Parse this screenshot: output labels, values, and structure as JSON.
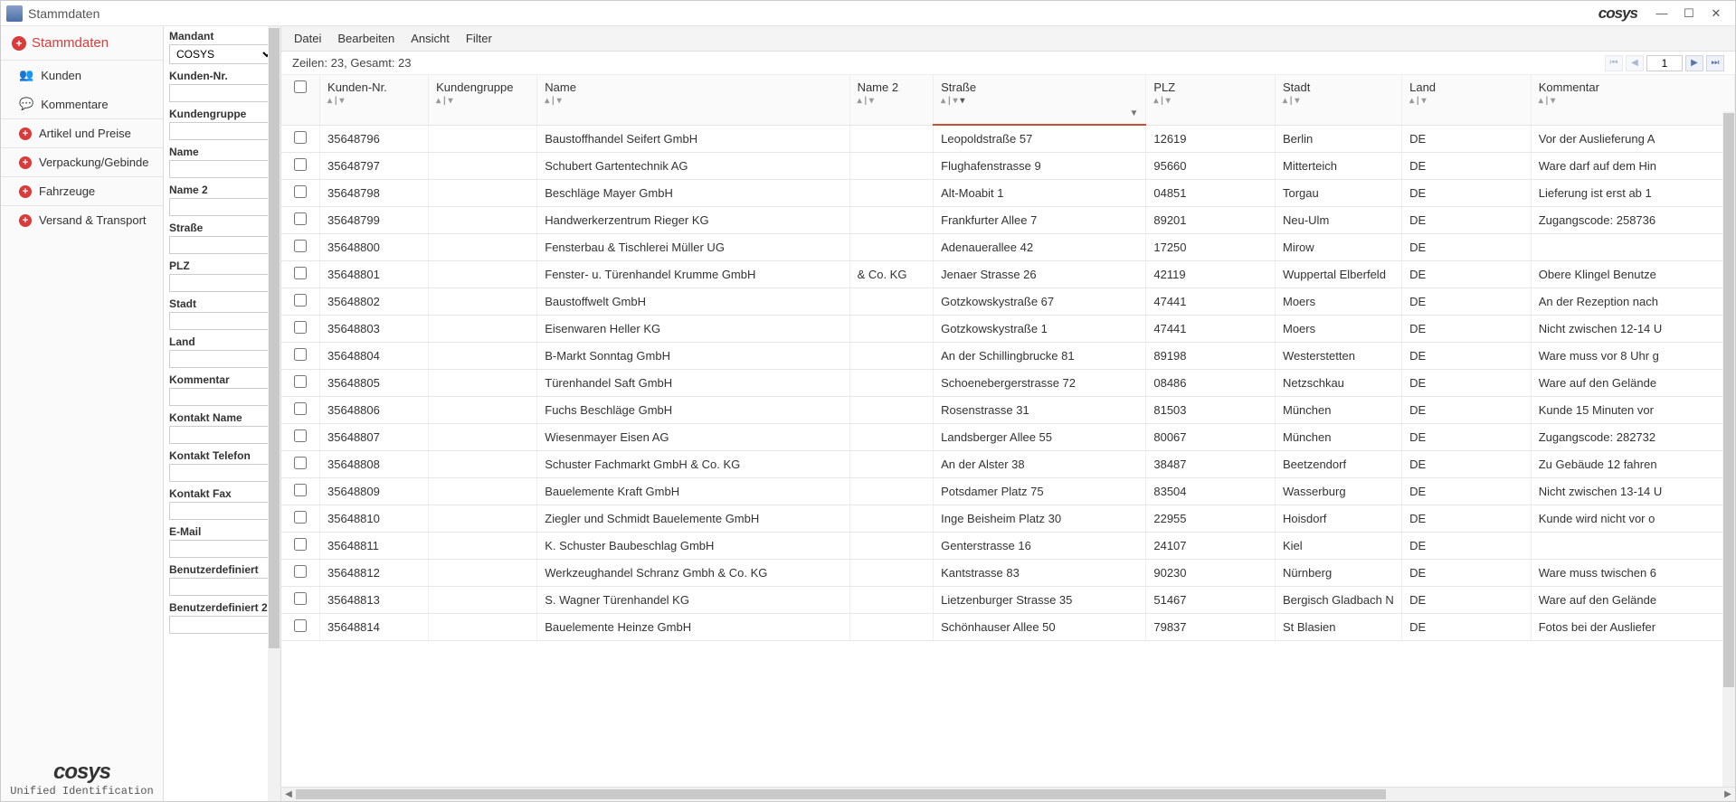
{
  "window": {
    "title": "Stammdaten",
    "brand": "cosys"
  },
  "winbuttons": {
    "min": "—",
    "max": "☐",
    "close": "✕"
  },
  "sidebar": {
    "header": "Stammdaten",
    "items": [
      {
        "label": "Kunden",
        "icon": "people"
      },
      {
        "label": "Kommentare",
        "icon": "comment"
      },
      {
        "label": "Artikel und Preise",
        "icon": "bullet"
      },
      {
        "label": "Verpackung/Gebinde",
        "icon": "bullet"
      },
      {
        "label": "Fahrzeuge",
        "icon": "bullet"
      },
      {
        "label": "Versand & Transport",
        "icon": "bullet"
      }
    ],
    "logo": {
      "text": "cosys",
      "subline": "Unified Identification"
    }
  },
  "filters": {
    "labels": [
      "Mandant",
      "Kunden-Nr.",
      "Kundengruppe",
      "Name",
      "Name 2",
      "Straße",
      "PLZ",
      "Stadt",
      "Land",
      "Kommentar",
      "Kontakt Name",
      "Kontakt Telefon",
      "Kontakt Fax",
      "E-Mail",
      "Benutzerdefiniert",
      "Benutzerdefiniert 2"
    ],
    "mandant_value": "COSYS"
  },
  "menu": {
    "items": [
      "Datei",
      "Bearbeiten",
      "Ansicht",
      "Filter"
    ]
  },
  "status": {
    "text": "Zeilen: 23, Gesamt: 23",
    "page": "1"
  },
  "columns": [
    {
      "key": "check",
      "label": ""
    },
    {
      "key": "nr",
      "label": "Kunden-Nr."
    },
    {
      "key": "group",
      "label": "Kundengruppe"
    },
    {
      "key": "name",
      "label": "Name"
    },
    {
      "key": "name2",
      "label": "Name 2"
    },
    {
      "key": "street",
      "label": "Straße",
      "sorted": true
    },
    {
      "key": "plz",
      "label": "PLZ"
    },
    {
      "key": "city",
      "label": "Stadt"
    },
    {
      "key": "land",
      "label": "Land"
    },
    {
      "key": "kom",
      "label": "Kommentar"
    }
  ],
  "rows": [
    {
      "nr": "35648796",
      "name": "Baustoffhandel Seifert GmbH",
      "name2": "",
      "street": "Leopoldstraße 57",
      "plz": "12619",
      "city": "Berlin",
      "land": "DE",
      "kom": "Vor der Auslieferung A"
    },
    {
      "nr": "35648797",
      "name": "Schubert Gartentechnik AG",
      "name2": "",
      "street": "Flughafenstrasse 9",
      "plz": "95660",
      "city": "Mitterteich",
      "land": "DE",
      "kom": "Ware darf auf dem Hin"
    },
    {
      "nr": "35648798",
      "name": "Beschläge Mayer GmbH",
      "name2": "",
      "street": "Alt-Moabit 1",
      "plz": "04851",
      "city": "Torgau",
      "land": "DE",
      "kom": "Lieferung ist erst ab 1"
    },
    {
      "nr": "35648799",
      "name": "Handwerkerzentrum Rieger KG",
      "name2": "",
      "street": "Frankfurter Allee 7",
      "plz": "89201",
      "city": "Neu-Ulm",
      "land": "DE",
      "kom": "Zugangscode: 258736"
    },
    {
      "nr": "35648800",
      "name": "Fensterbau & Tischlerei Müller UG",
      "name2": "",
      "street": "Adenauerallee 42",
      "plz": "17250",
      "city": "Mirow",
      "land": "DE",
      "kom": ""
    },
    {
      "nr": "35648801",
      "name": "Fenster- u. Türenhandel Krumme GmbH",
      "name2": "& Co. KG",
      "street": "Jenaer Strasse 26",
      "plz": "42119",
      "city": "Wuppertal Elberfeld",
      "land": "DE",
      "kom": "Obere Klingel Benutze"
    },
    {
      "nr": "35648802",
      "name": "Baustoffwelt GmbH",
      "name2": "",
      "street": "Gotzkowskystraße 67",
      "plz": "47441",
      "city": "Moers",
      "land": "DE",
      "kom": "An der Rezeption nach"
    },
    {
      "nr": "35648803",
      "name": "Eisenwaren Heller KG",
      "name2": "",
      "street": "Gotzkowskystraße 1",
      "plz": "47441",
      "city": "Moers",
      "land": "DE",
      "kom": "Nicht zwischen 12-14 U"
    },
    {
      "nr": "35648804",
      "name": "B-Markt Sonntag GmbH",
      "name2": "",
      "street": "An der Schillingbrucke 81",
      "plz": "89198",
      "city": "Westerstetten",
      "land": "DE",
      "kom": "Ware muss vor 8 Uhr g"
    },
    {
      "nr": "35648805",
      "name": "Türenhandel Saft GmbH",
      "name2": "",
      "street": "Schoenebergerstrasse 72",
      "plz": "08486",
      "city": "Netzschkau",
      "land": "DE",
      "kom": "Ware auf den Gelände"
    },
    {
      "nr": "35648806",
      "name": "Fuchs Beschläge GmbH",
      "name2": "",
      "street": "Rosenstrasse 31",
      "plz": "81503",
      "city": "München",
      "land": "DE",
      "kom": "Kunde 15 Minuten vor"
    },
    {
      "nr": "35648807",
      "name": "Wiesenmayer Eisen AG",
      "name2": "",
      "street": "Landsberger Allee 55",
      "plz": "80067",
      "city": "München",
      "land": "DE",
      "kom": "Zugangscode: 282732"
    },
    {
      "nr": "35648808",
      "name": "Schuster Fachmarkt GmbH & Co. KG",
      "name2": "",
      "street": "An der Alster 38",
      "plz": "38487",
      "city": "Beetzendorf",
      "land": "DE",
      "kom": "Zu Gebäude 12 fahren"
    },
    {
      "nr": "35648809",
      "name": "Bauelemente Kraft GmbH",
      "name2": "",
      "street": "Potsdamer Platz 75",
      "plz": "83504",
      "city": "Wasserburg",
      "land": "DE",
      "kom": "Nicht zwischen 13-14 U"
    },
    {
      "nr": "35648810",
      "name": "Ziegler und Schmidt Bauelemente GmbH",
      "name2": "",
      "street": "Inge Beisheim Platz 30",
      "plz": "22955",
      "city": "Hoisdorf",
      "land": "DE",
      "kom": "Kunde wird nicht vor o"
    },
    {
      "nr": "35648811",
      "name": "K. Schuster Baubeschlag GmbH",
      "name2": "",
      "street": "Genterstrasse 16",
      "plz": "24107",
      "city": "Kiel",
      "land": "DE",
      "kom": ""
    },
    {
      "nr": "35648812",
      "name": "Werkzeughandel Schranz Gmbh & Co. KG",
      "name2": "",
      "street": "Kantstrasse 83",
      "plz": "90230",
      "city": "Nürnberg",
      "land": "DE",
      "kom": "Ware muss twischen 6"
    },
    {
      "nr": "35648813",
      "name": "S. Wagner Türenhandel KG",
      "name2": "",
      "street": "Lietzenburger Strasse 35",
      "plz": "51467",
      "city": "Bergisch Gladbach N",
      "land": "DE",
      "kom": "Ware auf den Gelände"
    },
    {
      "nr": "35648814",
      "name": "Bauelemente Heinze GmbH",
      "name2": "",
      "street": "Schönhauser Allee 50",
      "plz": "79837",
      "city": "St Blasien",
      "land": "DE",
      "kom": "Fotos bei der Ausliefer"
    }
  ]
}
